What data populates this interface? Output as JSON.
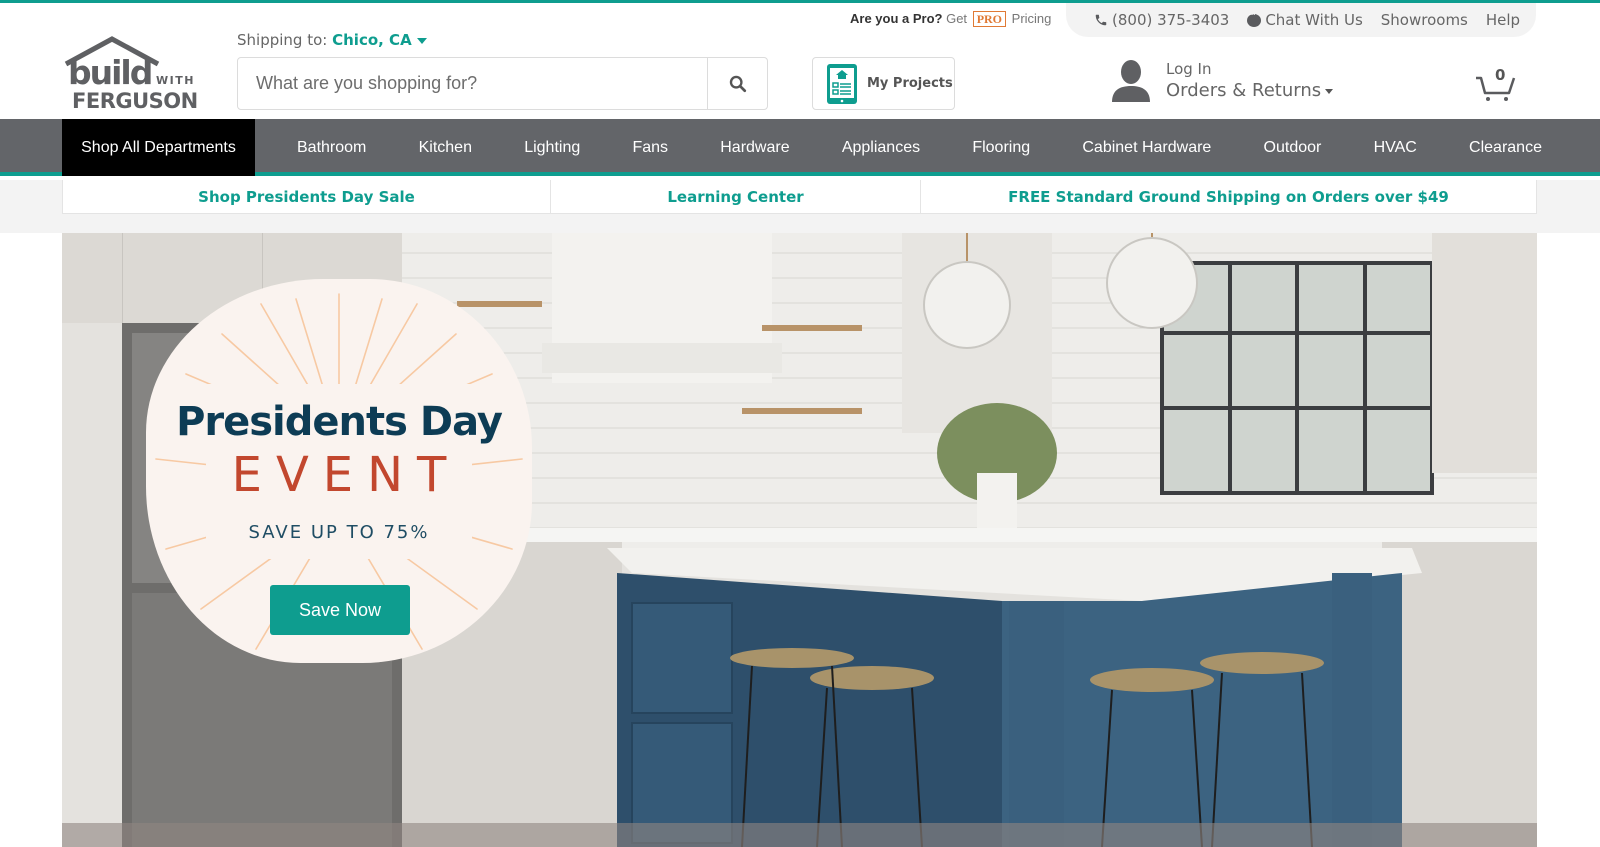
{
  "utility": {
    "pro_question": "Are you a Pro?",
    "pro_get": "Get",
    "pro_badge": "PRO",
    "pro_pricing": "Pricing",
    "phone": "(800) 375-3403",
    "chat": "Chat With Us",
    "showrooms": "Showrooms",
    "help": "Help"
  },
  "header": {
    "logo_build": "build",
    "logo_with": "WITH",
    "logo_ferguson": "FERGUSON",
    "shipping_label": "Shipping to:",
    "shipping_location": "Chico, CA",
    "search_placeholder": "What are you shopping for?",
    "my_projects": "My Projects",
    "login": "Log In",
    "orders_returns": "Orders & Returns",
    "cart_count": "0"
  },
  "nav": {
    "all_departments": "Shop All Departments",
    "items": [
      "Bathroom",
      "Kitchen",
      "Lighting",
      "Fans",
      "Hardware",
      "Appliances",
      "Flooring",
      "Cabinet Hardware",
      "Outdoor",
      "HVAC",
      "Clearance"
    ]
  },
  "promo_strip": {
    "items": [
      "Shop Presidents Day Sale",
      "Learning Center",
      "FREE Standard Ground Shipping on Orders over $49"
    ]
  },
  "hero": {
    "title": "Presidents Day",
    "subtitle": "EVENT",
    "tagline": "SAVE UP TO 75%",
    "cta": "Save Now",
    "image_alt": "Kitchen with navy blue island, white countertop, woven bar stools and glass pendant lights"
  },
  "colors": {
    "brand_teal": "#0e9d8f",
    "nav_gray": "#636569",
    "hero_navy": "#0d3c55",
    "hero_red": "#c2472e",
    "pro_orange": "#e07a35"
  }
}
